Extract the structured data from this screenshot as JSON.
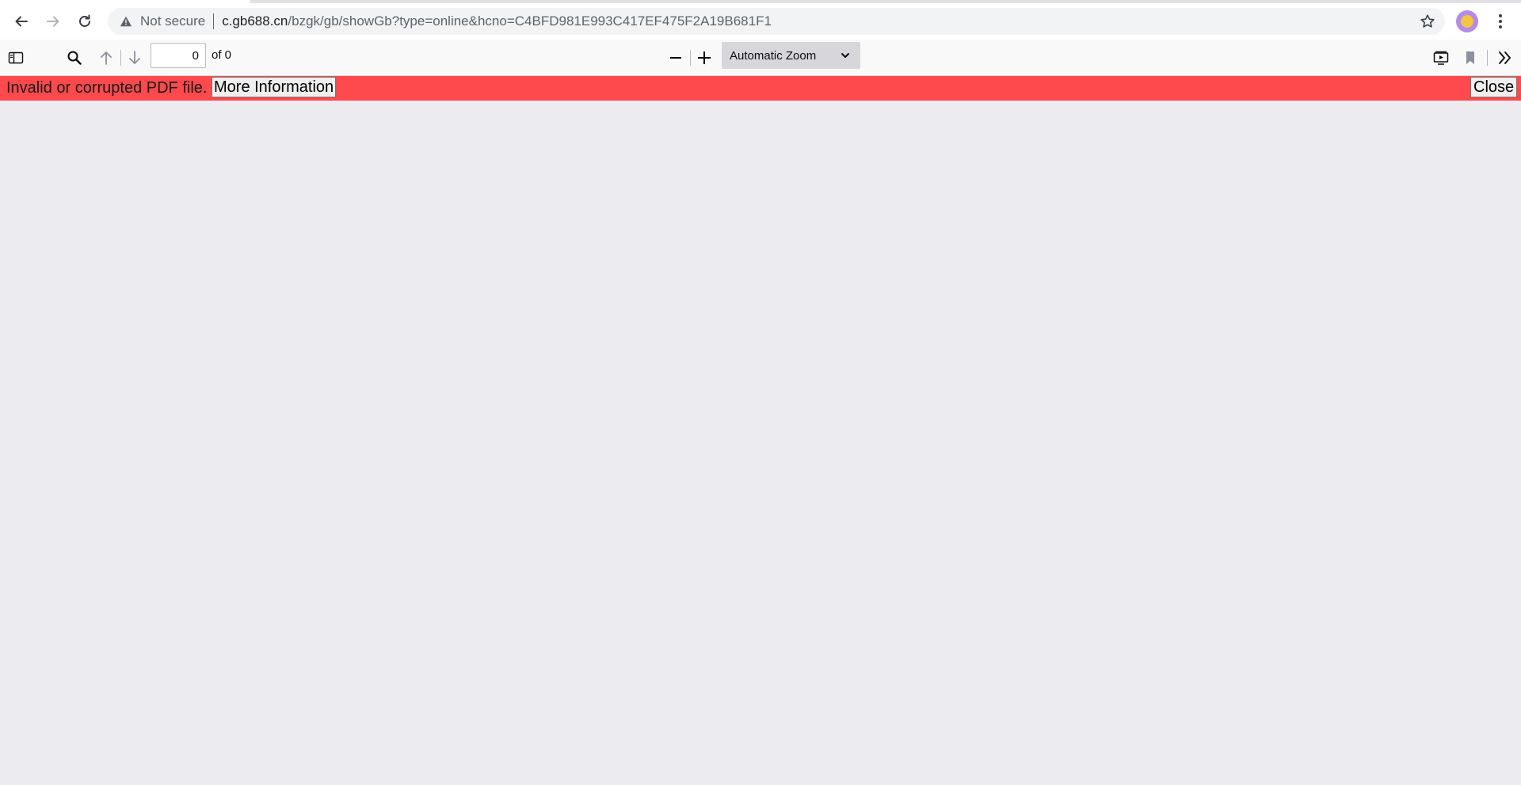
{
  "browser": {
    "security_label": "Not secure",
    "url_host": "c.gb688.cn",
    "url_path": "/bzgk/gb/showGb?type=online&hcno=C4BFD981E993C417EF475F2A19B681F1",
    "icons": [
      "back-arrow-icon",
      "forward-arrow-icon",
      "reload-icon",
      "warning-icon",
      "star-icon",
      "profile-avatar",
      "kebab-menu-icon"
    ]
  },
  "pdf_toolbar": {
    "page_number": "0",
    "page_count_label": "of 0",
    "zoom_label": "Automatic Zoom",
    "icons": [
      "sidebar-toggle-icon",
      "search-icon",
      "previous-page-icon",
      "next-page-icon",
      "zoom-out-icon",
      "zoom-in-icon",
      "presentation-mode-icon",
      "bookmark-icon",
      "tools-chevron-icon"
    ]
  },
  "error_bar": {
    "message": "Invalid or corrupted PDF file.",
    "more_info_label": "More Information",
    "close_label": "Close",
    "color": "#ff4a4d"
  },
  "colors": {
    "viewer_background": "#ecebf0",
    "toolbar_background": "#f9f9fa",
    "omnibox_background": "#f1f3f4"
  }
}
